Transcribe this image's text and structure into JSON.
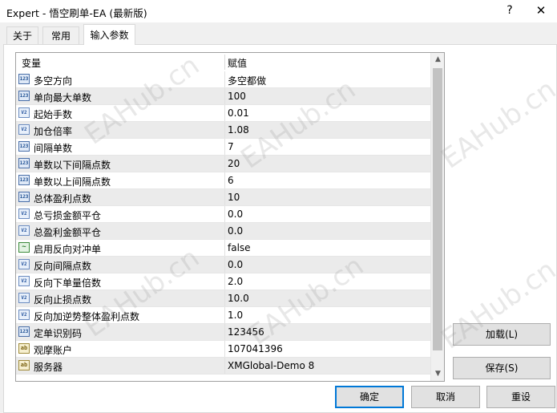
{
  "window": {
    "title": "Expert - 悟空刷单-EA (最新版)",
    "help_label": "?",
    "close_label": "✕"
  },
  "tabs": [
    {
      "label": "关于",
      "active": false
    },
    {
      "label": "常用",
      "active": false
    },
    {
      "label": "输入参数",
      "active": true
    }
  ],
  "grid": {
    "header_variable": "变量",
    "header_value": "赋值",
    "rows": [
      {
        "name": "多空方向",
        "value": "多空都做",
        "type": "int"
      },
      {
        "name": "单向最大单数",
        "value": "100",
        "type": "int"
      },
      {
        "name": "起始手数",
        "value": "0.01",
        "type": "double"
      },
      {
        "name": "加仓倍率",
        "value": "1.08",
        "type": "double"
      },
      {
        "name": "间隔单数",
        "value": "7",
        "type": "int"
      },
      {
        "name": "单数以下间隔点数",
        "value": "20",
        "type": "int"
      },
      {
        "name": "单数以上间隔点数",
        "value": "6",
        "type": "int"
      },
      {
        "name": "总体盈利点数",
        "value": "10",
        "type": "int"
      },
      {
        "name": "总亏损金额平仓",
        "value": "0.0",
        "type": "double"
      },
      {
        "name": "总盈利金额平仓",
        "value": "0.0",
        "type": "double"
      },
      {
        "name": "启用反向对冲单",
        "value": "false",
        "type": "bool"
      },
      {
        "name": "反向间隔点数",
        "value": "0.0",
        "type": "double"
      },
      {
        "name": "反向下单量倍数",
        "value": "2.0",
        "type": "double"
      },
      {
        "name": "反向止损点数",
        "value": "10.0",
        "type": "double"
      },
      {
        "name": "反向加逆势整体盈利点数",
        "value": "1.0",
        "type": "double"
      },
      {
        "name": "定单识别码",
        "value": "123456",
        "type": "int"
      },
      {
        "name": "观摩账户",
        "value": "107041396",
        "type": "string"
      },
      {
        "name": "服务器",
        "value": "XMGlobal-Demo 8",
        "type": "string"
      }
    ],
    "type_icons": {
      "int": "123",
      "double": "V2",
      "bool": "~",
      "string": "ab"
    }
  },
  "buttons": {
    "load": "加载(L)",
    "save": "保存(S)",
    "ok": "确定",
    "cancel": "取消",
    "reset": "重设"
  },
  "watermark": "EAHub.cn",
  "colors": {
    "accent": "#0078d7",
    "row_alt": "#ebebeb"
  }
}
